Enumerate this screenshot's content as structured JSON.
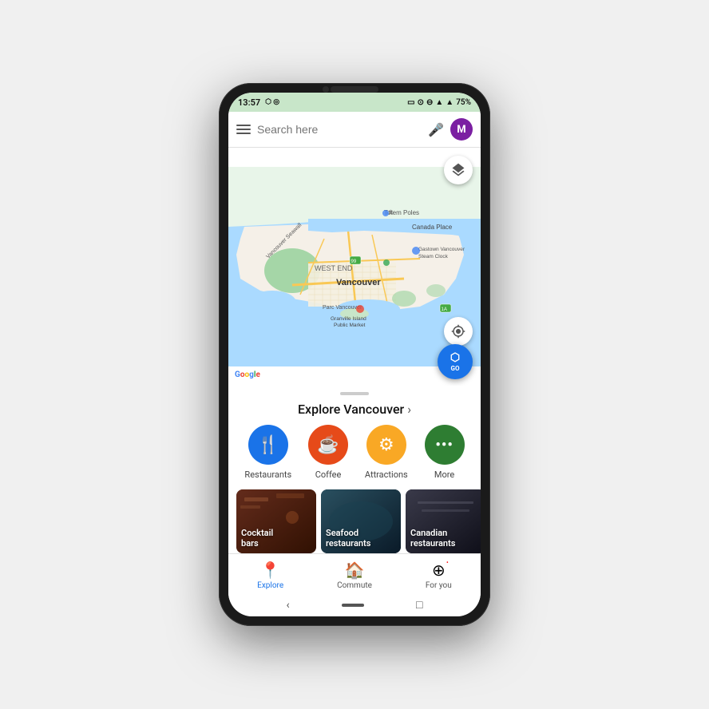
{
  "status_bar": {
    "time": "13:57",
    "battery": "75%"
  },
  "search": {
    "placeholder": "Search here"
  },
  "avatar_letter": "M",
  "map": {
    "city": "Vancouver",
    "labels": [
      "Totem Poles",
      "Vancouver Seawall",
      "Canada Place",
      "WEST END",
      "Parc Vancouver",
      "Granville Island\nPublic Market",
      "Gastown Vancouver\nSteam Clock"
    ],
    "layers_btn": "layers",
    "location_btn": "my-location",
    "go_btn": "GO"
  },
  "explore": {
    "title": "Explore Vancouver",
    "arrow": "›",
    "categories": [
      {
        "id": "restaurants",
        "label": "Restaurants",
        "color": "#1a73e8",
        "icon": "🍴"
      },
      {
        "id": "coffee",
        "label": "Coffee",
        "color": "#e64a19",
        "icon": "☕"
      },
      {
        "id": "attractions",
        "label": "Attractions",
        "color": "#f9a825",
        "icon": "⚙"
      },
      {
        "id": "more",
        "label": "More",
        "color": "#2e7d32",
        "icon": "···"
      }
    ],
    "places": [
      {
        "id": "cocktail-bars",
        "label": "Cocktail\nbars",
        "color1": "#5d2e1a",
        "color2": "#8d4e2a"
      },
      {
        "id": "seafood-restaurants",
        "label": "Seafood\nrestaurants",
        "color1": "#1a3a4a",
        "color2": "#2a5a6a"
      },
      {
        "id": "canadian-restaurants",
        "label": "Canadian\nrestaurants",
        "color1": "#2a2a3a",
        "color2": "#4a4a5a"
      }
    ]
  },
  "bottom_nav": [
    {
      "id": "explore",
      "label": "Explore",
      "icon": "📍",
      "active": true
    },
    {
      "id": "commute",
      "label": "Commute",
      "icon": "🏠"
    },
    {
      "id": "for-you",
      "label": "For you",
      "icon": "⊕"
    }
  ],
  "system_nav": {
    "back": "‹",
    "home": "",
    "recents": "□"
  }
}
